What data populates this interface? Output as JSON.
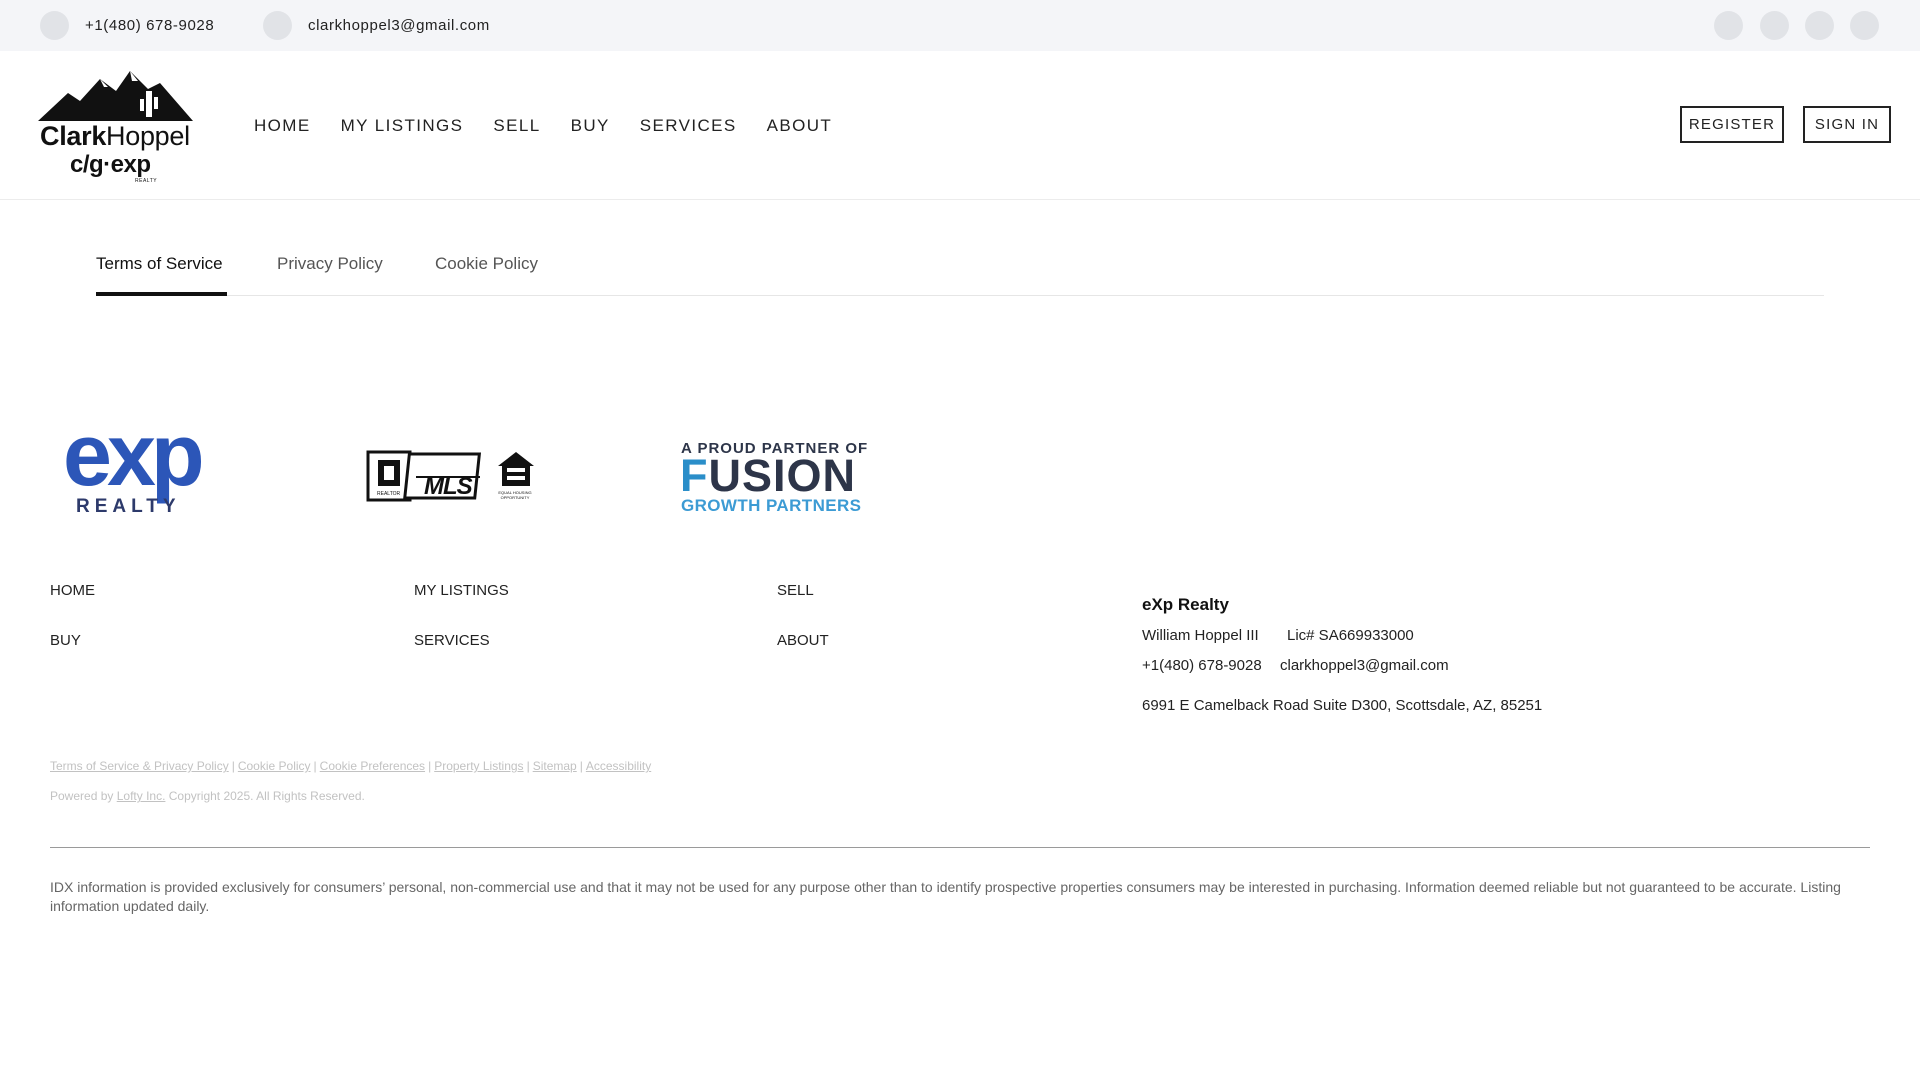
{
  "topbar": {
    "phone": "+1(480) 678-9028",
    "email": "clarkhoppel3@gmail.com",
    "social_icons": [
      "social-icon",
      "social-icon",
      "social-icon",
      "social-icon"
    ]
  },
  "logo": {
    "brand_bold": "Clark",
    "brand_rest": "Hoppel",
    "sub": "c/g·exp",
    "sub_small": "REALTY"
  },
  "nav": {
    "items": [
      "HOME",
      "MY LISTINGS",
      "SELL",
      "BUY",
      "SERVICES",
      "ABOUT"
    ],
    "register": "REGISTER",
    "sign_in": "SIGN IN"
  },
  "tabs": [
    {
      "label": "Terms of Service",
      "active": true
    },
    {
      "label": "Privacy Policy",
      "active": false
    },
    {
      "label": "Cookie Policy",
      "active": false
    }
  ],
  "partner_logos": {
    "exp": {
      "word": "exp",
      "sub": "REALTY"
    },
    "mls": {
      "text": "MLS",
      "sub": "REALTOR",
      "eho": "EQUAL HOUSING OPPORTUNITY"
    },
    "fusion": {
      "line1": "A PROUD PARTNER OF",
      "line2": "FUSION",
      "line3": "GROWTH PARTNERS"
    }
  },
  "footer_links": {
    "col1": [
      "HOME",
      "BUY"
    ],
    "col2": [
      "MY LISTINGS",
      "SERVICES"
    ],
    "col3": [
      "SELL",
      "ABOUT"
    ]
  },
  "company": {
    "name": "eXp Realty",
    "agent": "William Hoppel III",
    "license": "Lic# SA669933000",
    "phone": "+1(480) 678-9028",
    "email": "clarkhoppel3@gmail.com",
    "address": "6991 E Camelback Road Suite D300, Scottsdale, AZ, 85251"
  },
  "legal": {
    "links": [
      "Terms of Service & Privacy Policy",
      "Cookie Policy",
      "Cookie Preferences",
      "Property Listings",
      "Sitemap",
      "Accessibility"
    ],
    "powered_prefix": "Powered by",
    "powered_link": "Lofty Inc.",
    "copyright": "Copyright 2025. All Rights Reserved."
  },
  "idx_disclaimer": "IDX information is provided exclusively for consumers’ personal, non-commercial use and that it may not be used for any purpose other than to identify prospective properties consumers may be interested in purchasing. Information deemed reliable but not guaranteed to be accurate. Listing information updated daily.",
  "colors": {
    "topbar_bg": "#f4f5f8",
    "exp_blue": "#2c56b8",
    "fusion_blue": "#2a8ec9"
  }
}
